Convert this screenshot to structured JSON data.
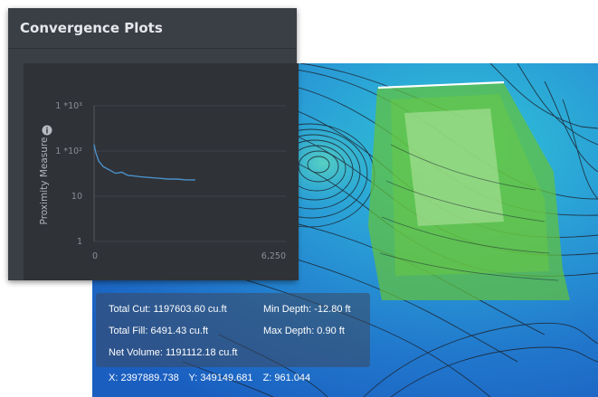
{
  "panel": {
    "title": "Convergence Plots"
  },
  "plot": {
    "ylabel": "Proximity Measure",
    "info_icon": "info-icon",
    "line_color": "#4a90c8",
    "chart_data": {
      "type": "line",
      "y_scale": "log",
      "y_ticks": [
        "1 *10³",
        "1 *10²",
        "10",
        "1"
      ],
      "y_tick_values": [
        1000,
        100,
        10,
        1
      ],
      "x_ticks": [
        "0",
        "6,250"
      ],
      "x_tick_values": [
        0,
        6250
      ],
      "xlim": [
        0,
        6250
      ],
      "ylim": [
        1,
        1000
      ],
      "series": [
        {
          "x": [
            0,
            50,
            150,
            300,
            500,
            700,
            900,
            1100,
            1300,
            1500,
            1800,
            2100,
            2400,
            2700,
            3000,
            3300
          ],
          "y": [
            140,
            95,
            60,
            45,
            38,
            32,
            34,
            29,
            28,
            27,
            26,
            25,
            24,
            24,
            23,
            23
          ]
        }
      ]
    }
  },
  "stats": {
    "total_cut": "Total Cut: 1197603.60 cu.ft",
    "min_depth": "Min Depth: -12.80 ft",
    "total_fill": "Total Fill: 6491.43 cu.ft",
    "max_depth": "Max Depth: 0.90 ft",
    "net_volume": "Net Volume: 1191112.18 cu.ft"
  },
  "coords": {
    "x": "X: 2397889.738",
    "y": "Y: 349149.681",
    "z": "Z: 961.044"
  }
}
